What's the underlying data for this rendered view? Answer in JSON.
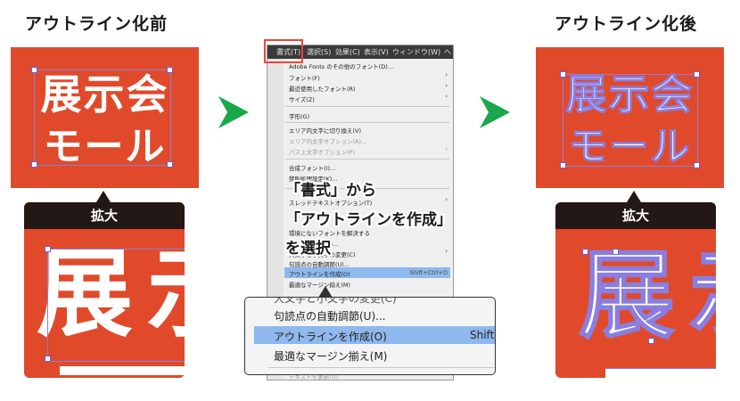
{
  "before": {
    "heading": "アウトライン化前",
    "line1": "展示会",
    "line2": "モール",
    "zoom_label": "拡大",
    "zoom_char1": "展",
    "zoom_char2": "示"
  },
  "after": {
    "heading": "アウトライン化後",
    "line1": "展示会",
    "line2": "モール",
    "zoom_label": "拡大",
    "zoom_char1": "展",
    "zoom_char2": "示"
  },
  "menubar": {
    "items": [
      "書式(T)",
      "選択(S)",
      "効果(C)",
      "表示(V)",
      "ウィンドウ(W)",
      "ヘ"
    ]
  },
  "menu": {
    "items": [
      {
        "label": "Adobe Fonts のその他のフォント(D)...",
        "sub": "",
        "disabled": false
      },
      {
        "label": "フォント(F)",
        "sub": "›",
        "disabled": false
      },
      {
        "label": "最近使用したフォント(R)",
        "sub": "›",
        "disabled": false
      },
      {
        "label": "サイズ(Z)",
        "sub": "›",
        "disabled": false
      },
      {
        "label": "字形(G)",
        "sub": "",
        "disabled": false
      },
      {
        "label": "エリア内文字に切り換え(V)",
        "sub": "",
        "disabled": false
      },
      {
        "label": "エリア内文字オプション(A)...",
        "sub": "",
        "disabled": true
      },
      {
        "label": "パス上文字オプション(P)",
        "sub": "›",
        "disabled": true
      },
      {
        "label": "合成フォント(I)...",
        "sub": "",
        "disabled": false
      },
      {
        "label": "禁則処理設定(K)...",
        "sub": "",
        "disabled": false
      },
      {
        "label": "スレッドテキストオプション(T)",
        "sub": "›",
        "disabled": false
      },
      {
        "label": "",
        "sub": "",
        "disabled": false
      },
      {
        "label": "環境にないフォントを解決する",
        "sub": "",
        "disabled": false
      },
      {
        "label": "フォント検索(N)...",
        "sub": "",
        "disabled": false
      },
      {
        "label": "大文字と小文字の変更(C)",
        "sub": "›",
        "disabled": false
      },
      {
        "label": "句読点の自動調節(U)...",
        "sub": "",
        "disabled": false
      },
      {
        "label": "アウトラインを作成(O)",
        "sub": "Shift+Ctrl+O",
        "disabled": false
      },
      {
        "label": "最適なマージン揃え(M)",
        "sub": "",
        "disabled": false
      },
      {
        "label": "テキストを更新(U)",
        "sub": "",
        "disabled": true
      }
    ]
  },
  "callout": {
    "line1": "「書式」から",
    "line2": "「アウトラインを作成」",
    "line3": "を選択"
  },
  "magnifier": {
    "top_partial": "大文字と小文字の変更(C)",
    "item1": "句読点の自動調節(U)...",
    "item2": "アウトラインを作成(O)",
    "item2_shortcut": "Shift",
    "item3": "最適なマージン揃え(M)"
  },
  "colors": {
    "card_red": "#e04a2a",
    "arrow_green": "#19a84b",
    "highlight_box": "#e8473a",
    "menu_highlight": "#8fb8ec"
  },
  "icons": {
    "arrow": "right-arrow-icon"
  }
}
